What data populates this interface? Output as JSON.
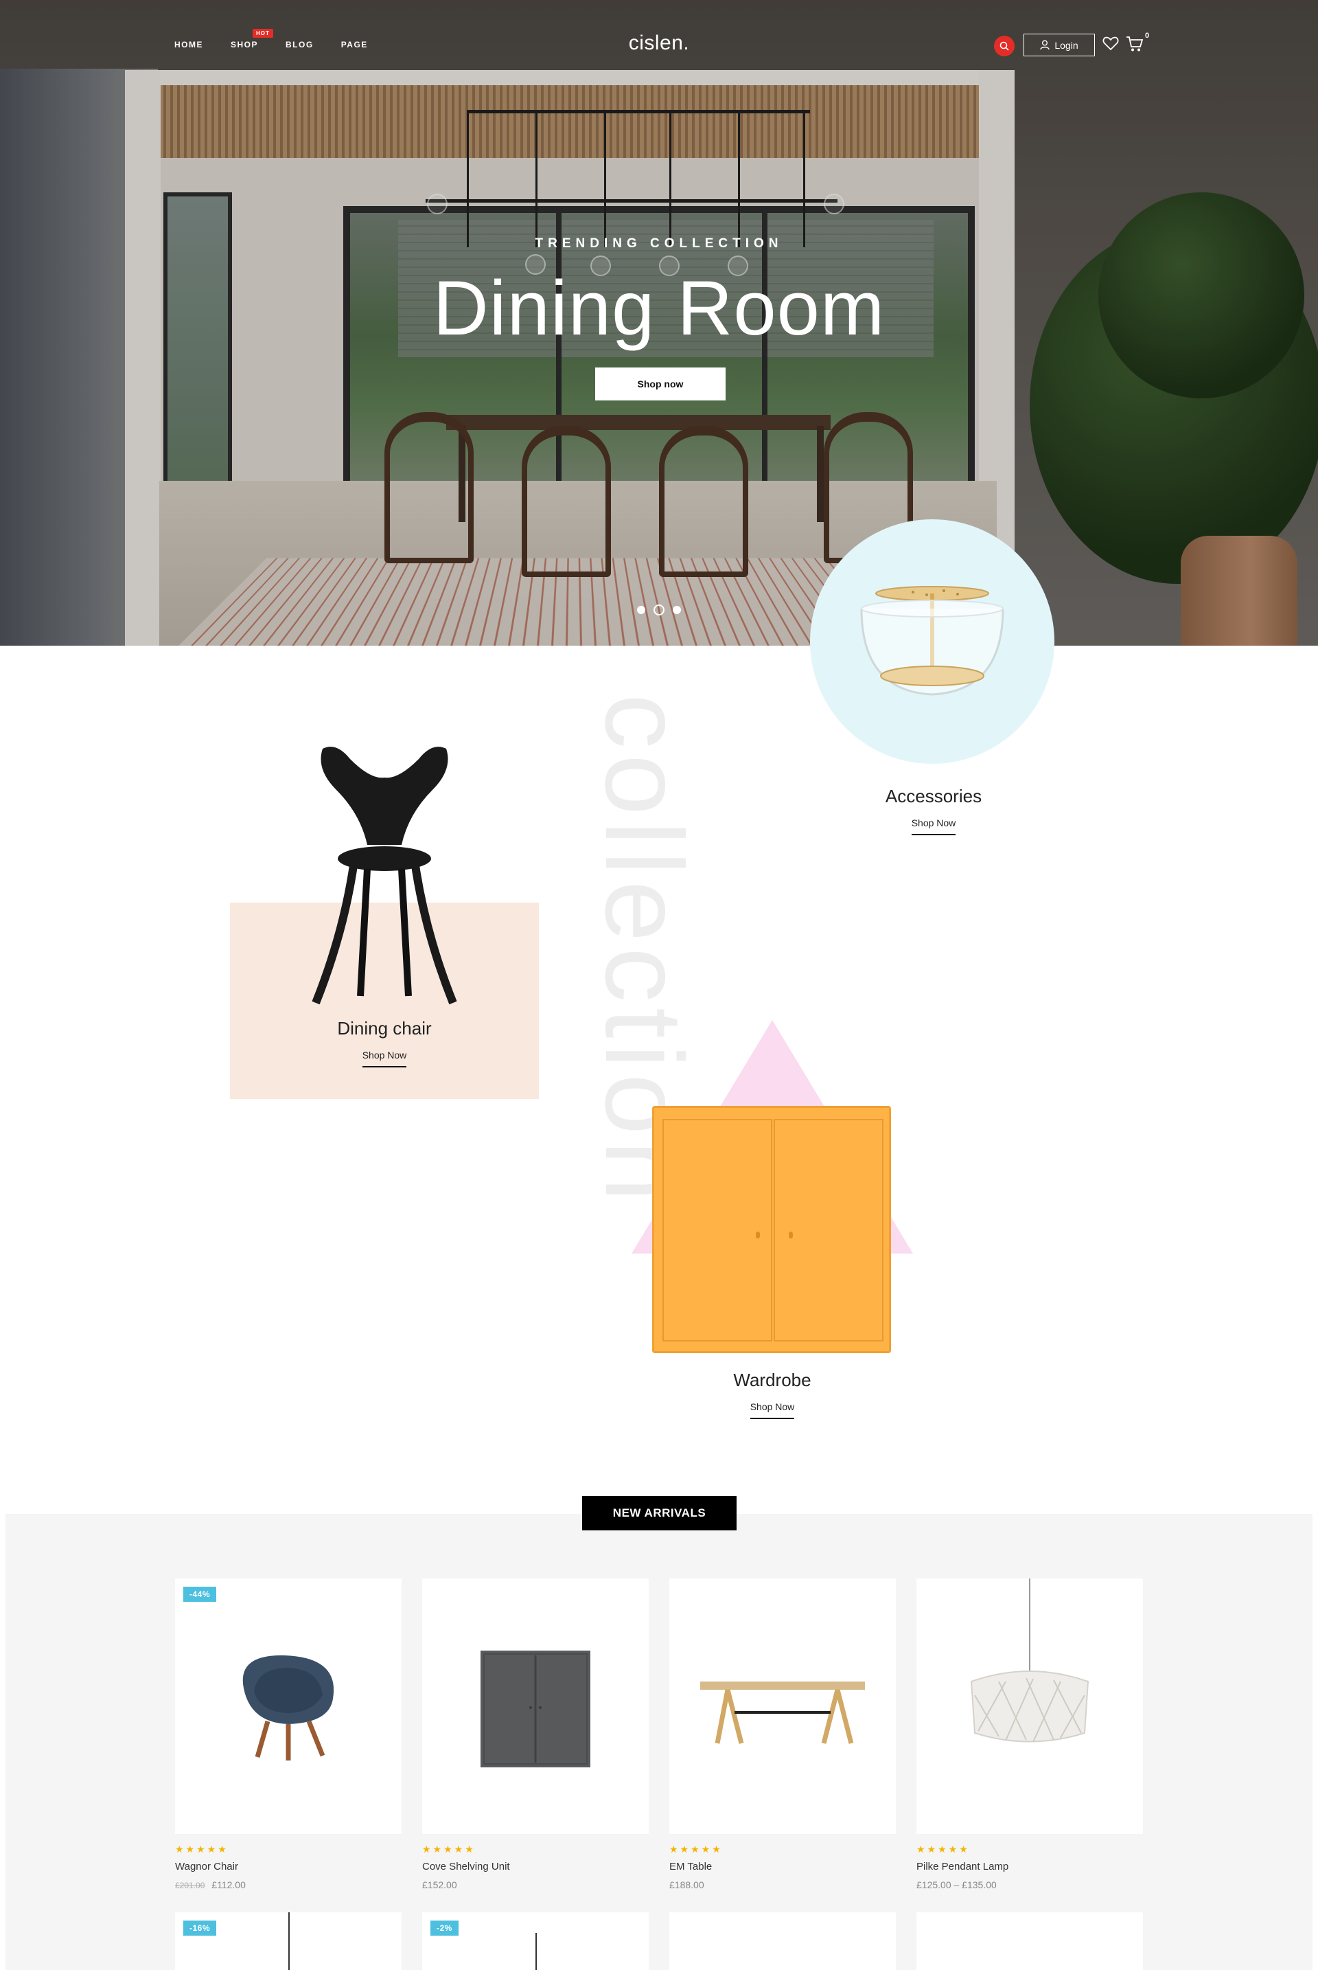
{
  "header": {
    "nav": [
      "HOME",
      "SHOP",
      "BLOG",
      "PAGE"
    ],
    "shop_badge": "HOT",
    "logo": "cislen.",
    "login_label": "Login",
    "cart_count": "0",
    "icons": [
      "search-icon",
      "user-icon",
      "heart-icon",
      "cart-icon"
    ],
    "accent_color": "#e52d27"
  },
  "hero": {
    "eyebrow": "TRENDING COLLECTION",
    "title": "Dining Room",
    "cta": "Shop now",
    "slides": 3,
    "active_slide": 2
  },
  "collection": {
    "vertical_word": "collection",
    "cards": [
      {
        "title": "Accessories",
        "link": "Shop Now",
        "bg_color": "#e2f6f9"
      },
      {
        "title": "Dining chair",
        "link": "Shop Now",
        "bg_color": "#f9e8de"
      },
      {
        "title": "Wardrobe",
        "link": "Shop Now",
        "bg_color": "#fadbf0"
      }
    ]
  },
  "arrivals": {
    "tab_label": "NEW ARRIVALS",
    "rating_stars": "★★★★★",
    "products": [
      {
        "name": "Wagnor Chair",
        "old_price": "£201.00",
        "price": "£112.00",
        "badge": "-44%"
      },
      {
        "name": "Cove Shelving Unit",
        "old_price": "",
        "price": "£152.00",
        "badge": ""
      },
      {
        "name": "EM Table",
        "old_price": "",
        "price": "£188.00",
        "badge": ""
      },
      {
        "name": "Pilke Pendant Lamp",
        "old_price": "",
        "price": "£125.00 – £135.00",
        "badge": ""
      }
    ],
    "row2_badges": [
      "-16%",
      "-2%",
      "",
      ""
    ],
    "badge_color": "#4cc0de",
    "star_color": "#f5b301"
  }
}
